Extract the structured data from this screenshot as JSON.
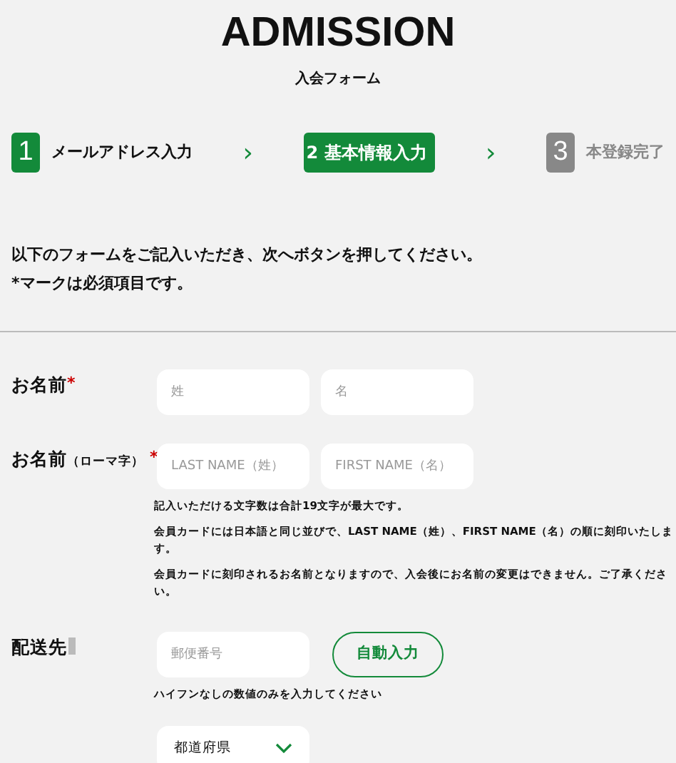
{
  "header": {
    "title": "ADMISSION",
    "subtitle": "入会フォーム"
  },
  "steps": [
    {
      "number": "1",
      "label": "メールアドレス入力",
      "kind": "done"
    },
    {
      "number": "2",
      "label": "基本情報入力",
      "kind": "current"
    },
    {
      "number": "3",
      "label": "本登録完了",
      "kind": "upcoming"
    }
  ],
  "step_separator": "›",
  "intro": [
    "以下のフォームをご記入いただき、次へボタンを押してください。",
    "*マークは必須項目です。"
  ],
  "fields": [
    {
      "label": "お名前",
      "required": true,
      "required_mark": "*",
      "inputs": [
        {
          "placeholder": "姓"
        },
        {
          "placeholder": "名"
        }
      ]
    },
    {
      "label": "お名前",
      "label_suffix": "（ローマ字）",
      "required": true,
      "required_mark": "*",
      "inputs": [
        {
          "placeholder": "LAST NAME（姓）"
        },
        {
          "placeholder": "FIRST NAME（名）"
        }
      ],
      "notes": [
        "記入いただける文字数は合計19文字が最大です。",
        "会員カードには日本語と同じ並びで、LAST NAME（姓）、FIRST NAME（名）の順に刻印いたします。",
        "会員カードに刻印されるお名前となりますので、入会後にお名前の変更はできません。ご了承ください。"
      ]
    },
    {
      "label": "配送先",
      "required": false,
      "inputs": [
        {
          "placeholder": "郵便番号"
        }
      ],
      "button": "自動入力",
      "notes": [
        "ハイフンなしの数値のみを入力してください"
      ],
      "select": {
        "value": "都道府県"
      }
    }
  ]
}
